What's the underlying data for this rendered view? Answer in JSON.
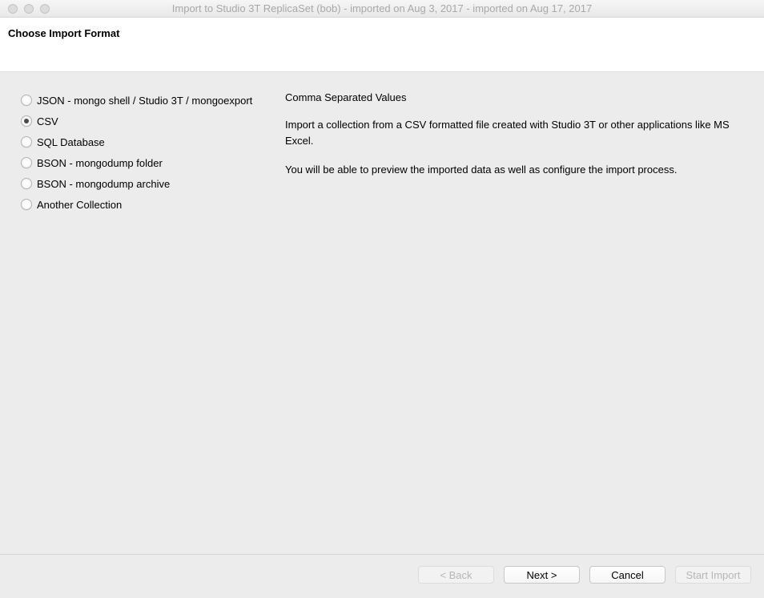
{
  "window": {
    "title": "Import to Studio 3T ReplicaSet (bob) - imported on Aug 3, 2017 - imported on Aug 17, 2017"
  },
  "header": {
    "title": "Choose Import Format"
  },
  "options": [
    {
      "label": "JSON - mongo shell / Studio 3T / mongoexport",
      "selected": false
    },
    {
      "label": "CSV",
      "selected": true
    },
    {
      "label": "SQL Database",
      "selected": false
    },
    {
      "label": "BSON - mongodump folder",
      "selected": false
    },
    {
      "label": "BSON - mongodump archive",
      "selected": false
    },
    {
      "label": "Another Collection",
      "selected": false
    }
  ],
  "description": {
    "title": "Comma Separated Values",
    "p1": "Import a collection from a CSV formatted file created with Studio 3T or other applications like MS Excel.",
    "p2": "You will be able to preview the imported data as well as configure the import process."
  },
  "buttons": {
    "back": "< Back",
    "next": "Next >",
    "cancel": "Cancel",
    "start": "Start Import"
  }
}
